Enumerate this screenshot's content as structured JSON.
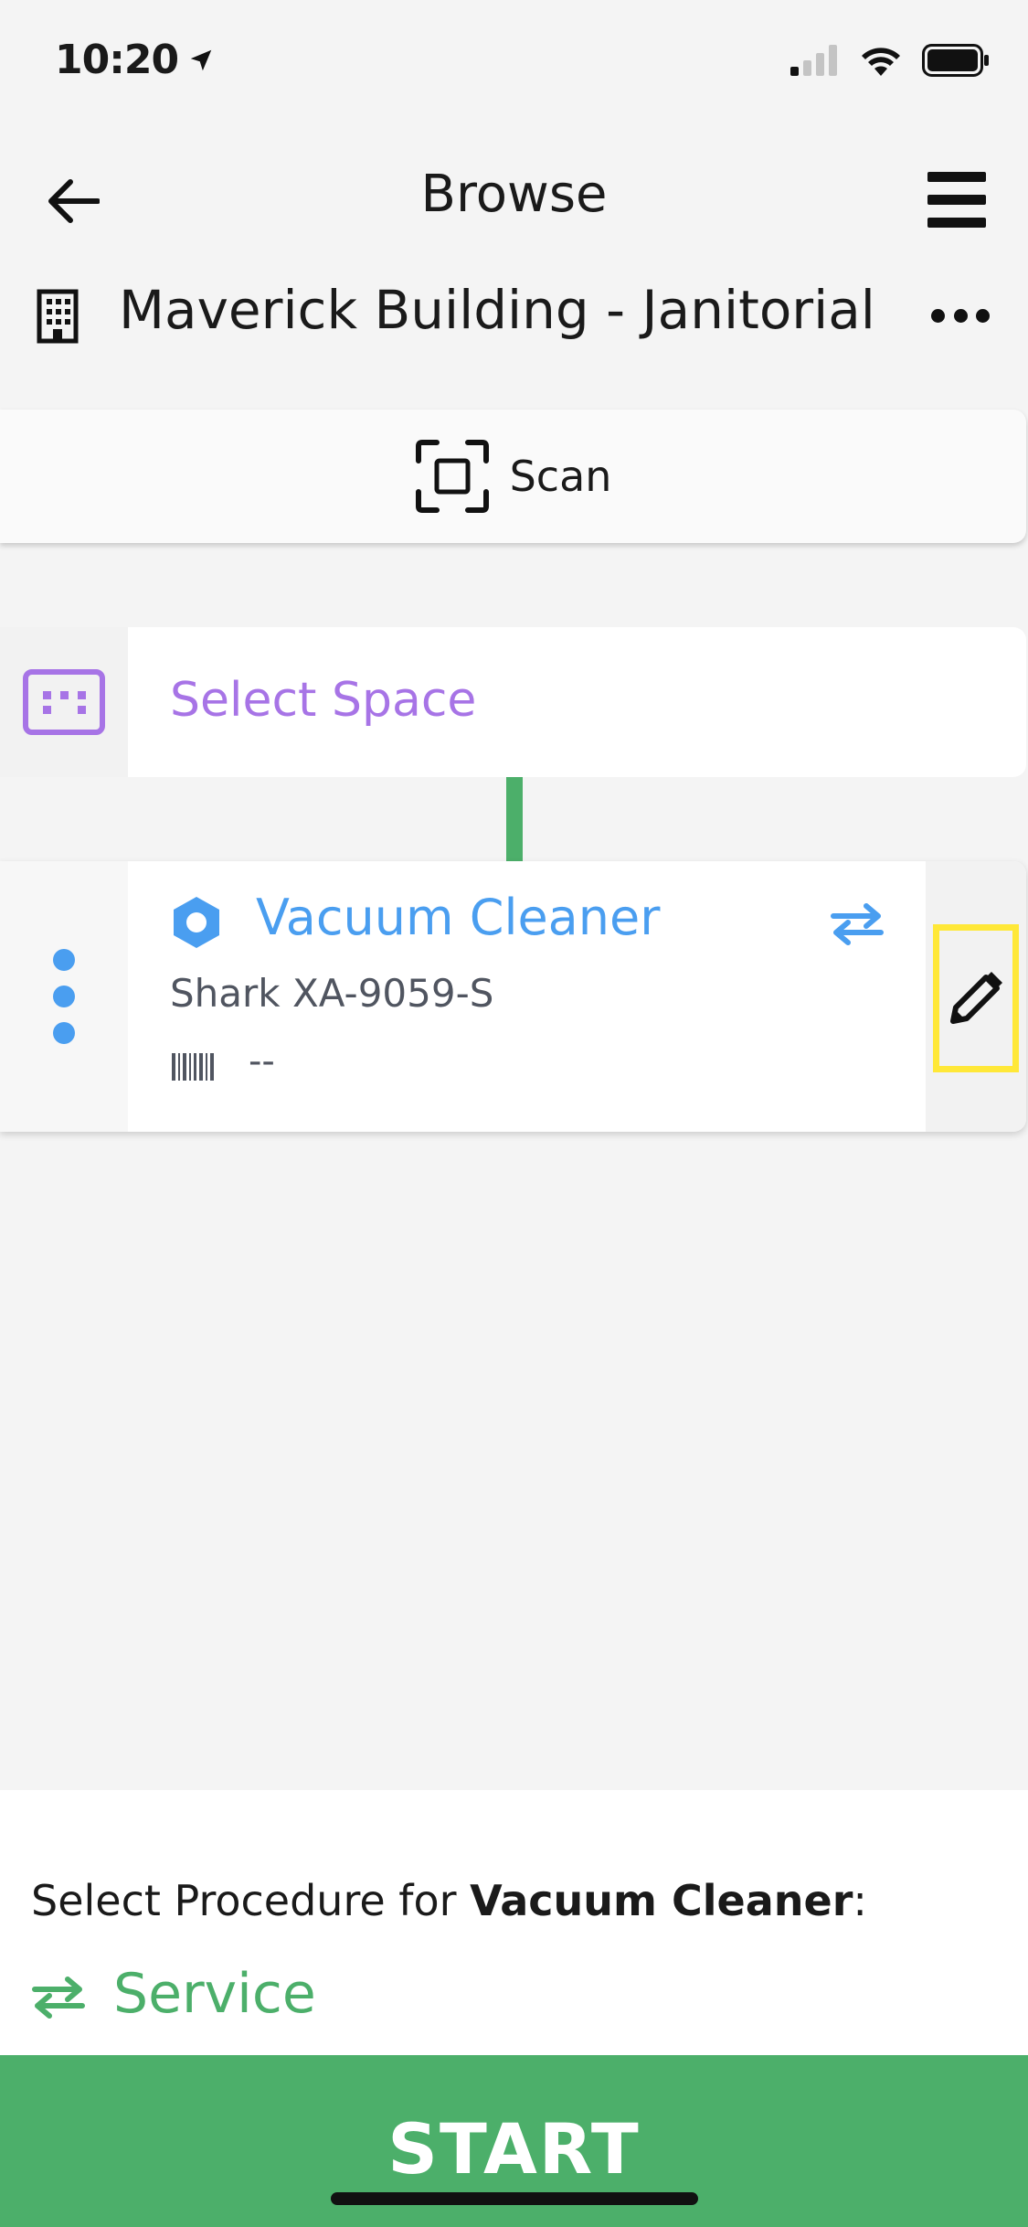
{
  "status_bar": {
    "time": "10:20",
    "location_icon": "location-arrow-icon",
    "signal_icon": "cellular-signal-icon",
    "wifi_icon": "wifi-icon",
    "battery_icon": "battery-icon"
  },
  "nav": {
    "back_icon": "arrow-left-icon",
    "title": "Browse",
    "menu_icon": "hamburger-menu-icon"
  },
  "building": {
    "icon": "building-icon",
    "name": "Maverick Building - Janitorial",
    "more_icon": "more-horizontal-icon"
  },
  "scan": {
    "icon": "scan-frame-icon",
    "label": "Scan"
  },
  "space": {
    "icon": "space-icon",
    "label": "Select Space",
    "color": "#a774e6"
  },
  "asset": {
    "type_icon": "hexagon-icon",
    "name": "Vacuum Cleaner",
    "swap_icon": "swap-arrows-icon",
    "model": "Shark XA-9059-S",
    "barcode_icon": "barcode-icon",
    "barcode_value": "--",
    "menu_icon": "vertical-dots-icon",
    "edit_icon": "pencil-icon",
    "color": "#4a9ef0"
  },
  "procedure": {
    "prompt_prefix": "Select Procedure for ",
    "prompt_asset": "Vacuum Cleaner",
    "prompt_suffix": ":",
    "service_icon": "swap-arrows-icon",
    "service_label": "Service"
  },
  "start_button": {
    "label": "START",
    "color": "#4caf6a"
  },
  "highlight_color": "#ffe838"
}
